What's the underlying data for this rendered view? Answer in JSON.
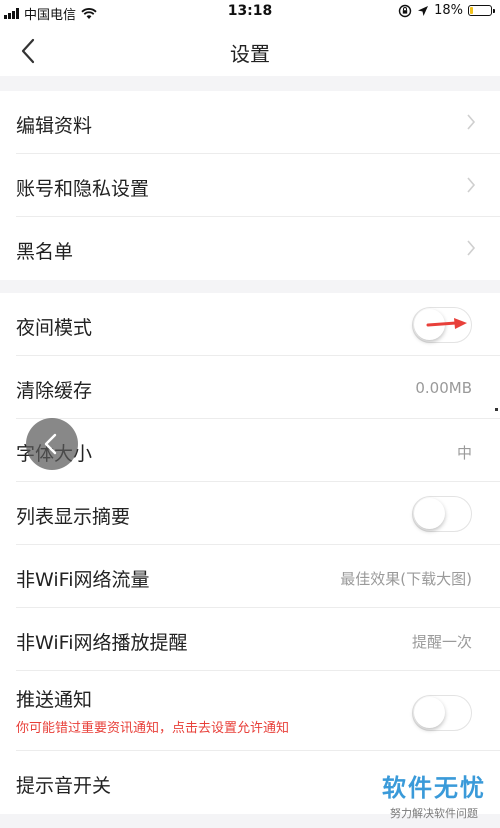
{
  "status_bar": {
    "carrier": "中国电信",
    "time": "13:18",
    "battery_percent": "18%",
    "battery_level": 0.18,
    "icons": [
      "signal-icon",
      "wifi-icon",
      "rotation-lock-icon",
      "location-icon",
      "battery-icon"
    ]
  },
  "nav": {
    "title": "设置",
    "back_icon": "chevron-left-icon"
  },
  "group1": {
    "items": [
      {
        "label": "编辑资料"
      },
      {
        "label": "账号和隐私设置"
      },
      {
        "label": "黑名单"
      }
    ]
  },
  "group2": {
    "night_mode": {
      "label": "夜间模式",
      "on": false
    },
    "clear_cache": {
      "label": "清除缓存",
      "value": "0.00MB"
    },
    "font_size": {
      "label": "字体大小",
      "value": "中"
    },
    "list_summary": {
      "label": "列表显示摘要",
      "on": false
    },
    "non_wifi_traffic": {
      "label": "非WiFi网络流量",
      "value": "最佳效果(下载大图)"
    },
    "non_wifi_playback": {
      "label": "非WiFi网络播放提醒",
      "value": "提醒一次"
    },
    "push": {
      "label": "推送通知",
      "hint": "你可能错过重要资讯通知，点击去设置允许通知",
      "on": false
    },
    "sound": {
      "label": "提示音开关"
    }
  },
  "watermark": {
    "title": "软件无忧",
    "subtitle": "努力解决软件问题"
  },
  "colors": {
    "accent_red": "#e8403a",
    "hint_red": "#e8403a",
    "watermark_blue": "#3a9ad9"
  }
}
